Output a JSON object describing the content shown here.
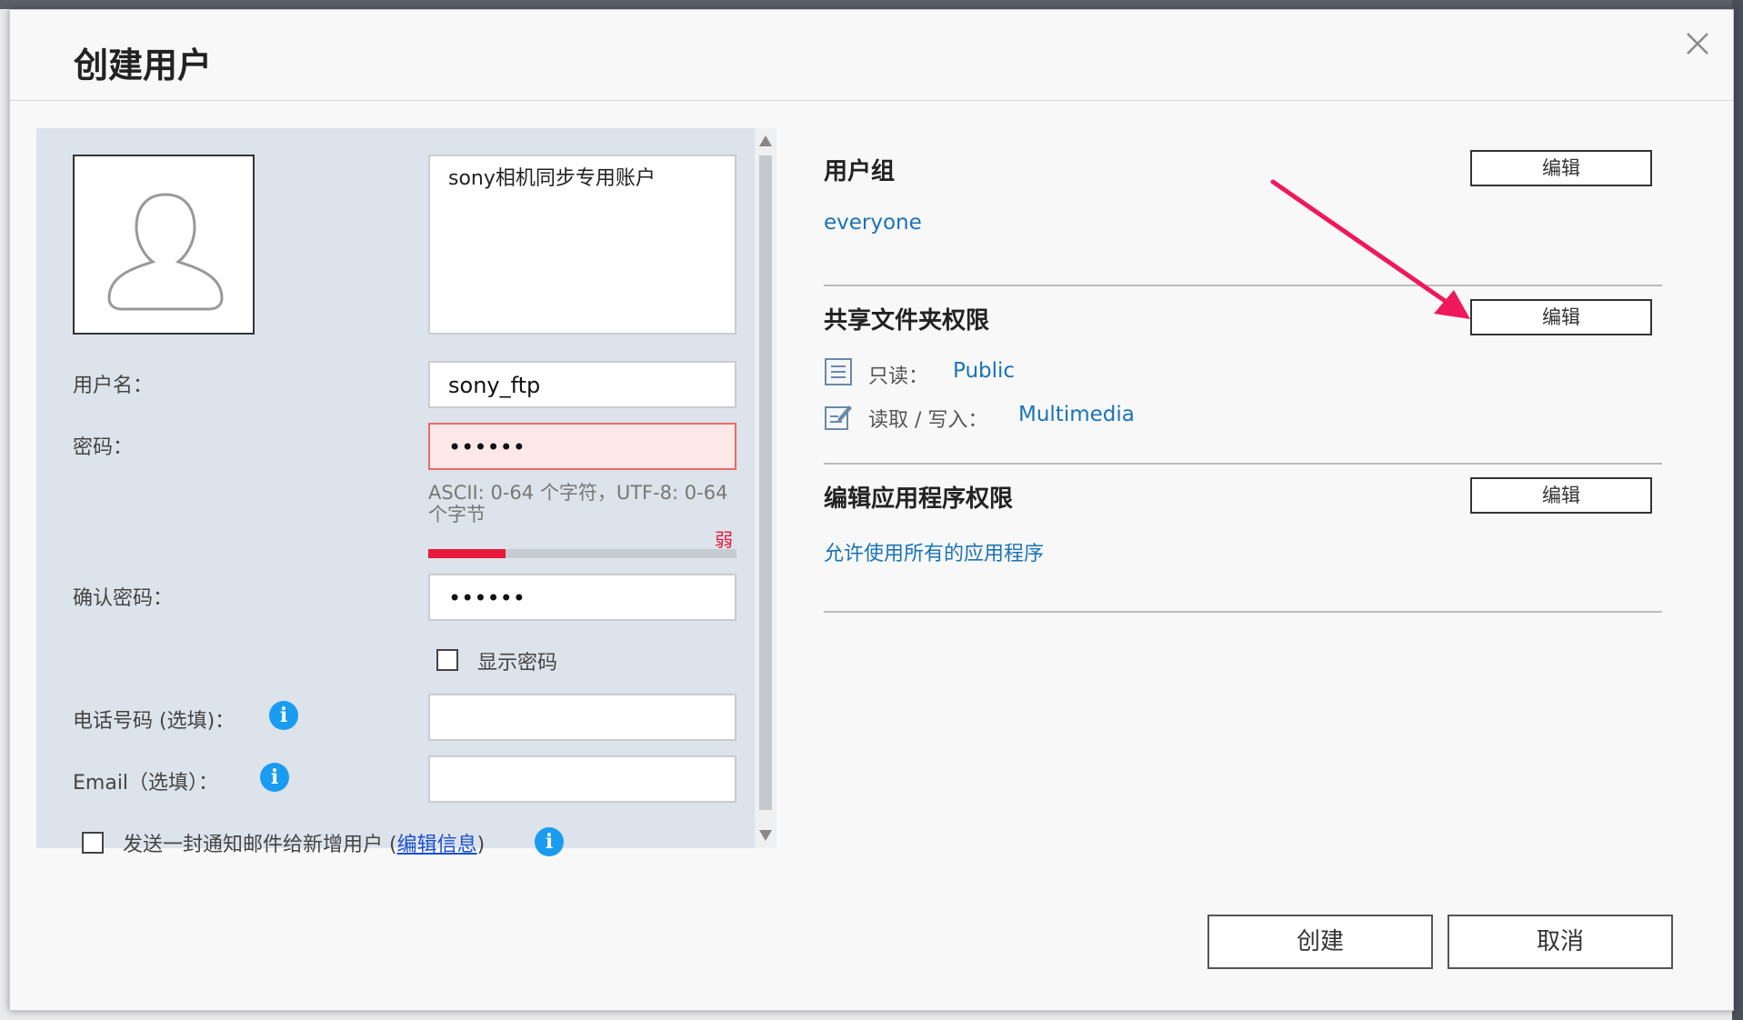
{
  "dialog": {
    "title": "创建用户"
  },
  "form": {
    "description_value": "sony相机同步专用账户",
    "username_label": "用户名：",
    "username_value": "sony_ftp",
    "password_label": "密码：",
    "password_value": "••••••",
    "password_hint": "ASCII: 0-64 个字符，UTF-8: 0-64 个字节",
    "strength_label": "弱",
    "strength_fraction": 0.25,
    "confirm_label": "确认密码：",
    "confirm_value": "••••••",
    "show_password_label": "显示密码",
    "phone_label": "电话号码 (选填)：",
    "email_label": "Email（选填）：",
    "notify_prefix": "发送一封通知邮件给新增用户 (",
    "notify_link": "编辑信息",
    "notify_suffix": ")"
  },
  "groups": {
    "title": "用户组",
    "edit_label": "编辑",
    "value": "everyone"
  },
  "shared_folders": {
    "title": "共享文件夹权限",
    "edit_label": "编辑",
    "readonly_label": "只读：",
    "readonly_value": "Public",
    "readwrite_label": "读取 / 写入：",
    "readwrite_value": "Multimedia"
  },
  "app_permissions": {
    "title": "编辑应用程序权限",
    "edit_label": "编辑",
    "value": "允许使用所有的应用程序"
  },
  "footer": {
    "create_label": "创建",
    "cancel_label": "取消"
  },
  "colors": {
    "accent_blue": "#1a73b8",
    "strength_red": "#e8183b",
    "annotation_arrow": "#f0185c",
    "info_blue": "#1a9cf0"
  },
  "icons": [
    "close-icon",
    "avatar-placeholder-icon",
    "info-icon",
    "readonly-doc-icon",
    "readwrite-edit-icon",
    "scroll-up-icon",
    "scroll-down-icon"
  ]
}
